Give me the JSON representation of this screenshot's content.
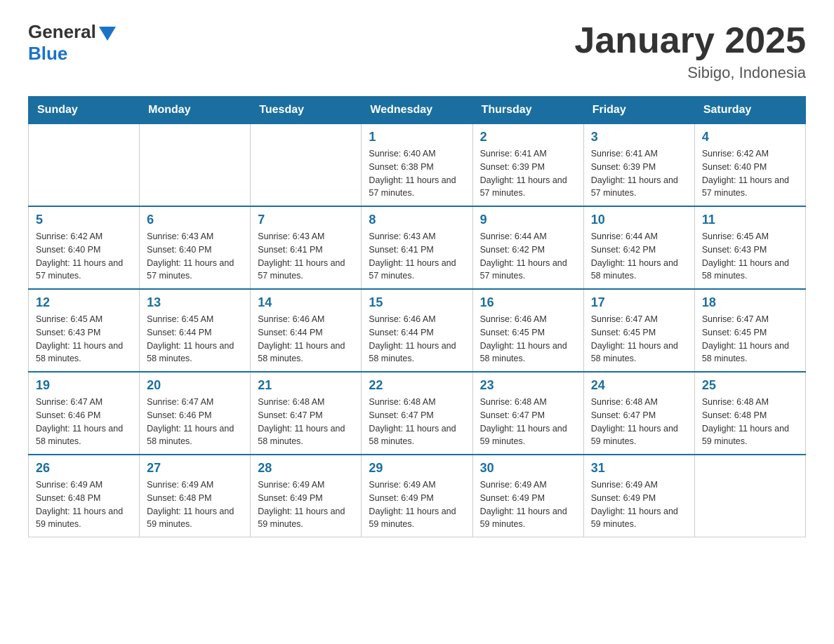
{
  "logo": {
    "general": "General",
    "blue": "Blue"
  },
  "title": "January 2025",
  "subtitle": "Sibigo, Indonesia",
  "days_of_week": [
    "Sunday",
    "Monday",
    "Tuesday",
    "Wednesday",
    "Thursday",
    "Friday",
    "Saturday"
  ],
  "weeks": [
    [
      {
        "day": "",
        "info": ""
      },
      {
        "day": "",
        "info": ""
      },
      {
        "day": "",
        "info": ""
      },
      {
        "day": "1",
        "info": "Sunrise: 6:40 AM\nSunset: 6:38 PM\nDaylight: 11 hours and 57 minutes."
      },
      {
        "day": "2",
        "info": "Sunrise: 6:41 AM\nSunset: 6:39 PM\nDaylight: 11 hours and 57 minutes."
      },
      {
        "day": "3",
        "info": "Sunrise: 6:41 AM\nSunset: 6:39 PM\nDaylight: 11 hours and 57 minutes."
      },
      {
        "day": "4",
        "info": "Sunrise: 6:42 AM\nSunset: 6:40 PM\nDaylight: 11 hours and 57 minutes."
      }
    ],
    [
      {
        "day": "5",
        "info": "Sunrise: 6:42 AM\nSunset: 6:40 PM\nDaylight: 11 hours and 57 minutes."
      },
      {
        "day": "6",
        "info": "Sunrise: 6:43 AM\nSunset: 6:40 PM\nDaylight: 11 hours and 57 minutes."
      },
      {
        "day": "7",
        "info": "Sunrise: 6:43 AM\nSunset: 6:41 PM\nDaylight: 11 hours and 57 minutes."
      },
      {
        "day": "8",
        "info": "Sunrise: 6:43 AM\nSunset: 6:41 PM\nDaylight: 11 hours and 57 minutes."
      },
      {
        "day": "9",
        "info": "Sunrise: 6:44 AM\nSunset: 6:42 PM\nDaylight: 11 hours and 57 minutes."
      },
      {
        "day": "10",
        "info": "Sunrise: 6:44 AM\nSunset: 6:42 PM\nDaylight: 11 hours and 58 minutes."
      },
      {
        "day": "11",
        "info": "Sunrise: 6:45 AM\nSunset: 6:43 PM\nDaylight: 11 hours and 58 minutes."
      }
    ],
    [
      {
        "day": "12",
        "info": "Sunrise: 6:45 AM\nSunset: 6:43 PM\nDaylight: 11 hours and 58 minutes."
      },
      {
        "day": "13",
        "info": "Sunrise: 6:45 AM\nSunset: 6:44 PM\nDaylight: 11 hours and 58 minutes."
      },
      {
        "day": "14",
        "info": "Sunrise: 6:46 AM\nSunset: 6:44 PM\nDaylight: 11 hours and 58 minutes."
      },
      {
        "day": "15",
        "info": "Sunrise: 6:46 AM\nSunset: 6:44 PM\nDaylight: 11 hours and 58 minutes."
      },
      {
        "day": "16",
        "info": "Sunrise: 6:46 AM\nSunset: 6:45 PM\nDaylight: 11 hours and 58 minutes."
      },
      {
        "day": "17",
        "info": "Sunrise: 6:47 AM\nSunset: 6:45 PM\nDaylight: 11 hours and 58 minutes."
      },
      {
        "day": "18",
        "info": "Sunrise: 6:47 AM\nSunset: 6:45 PM\nDaylight: 11 hours and 58 minutes."
      }
    ],
    [
      {
        "day": "19",
        "info": "Sunrise: 6:47 AM\nSunset: 6:46 PM\nDaylight: 11 hours and 58 minutes."
      },
      {
        "day": "20",
        "info": "Sunrise: 6:47 AM\nSunset: 6:46 PM\nDaylight: 11 hours and 58 minutes."
      },
      {
        "day": "21",
        "info": "Sunrise: 6:48 AM\nSunset: 6:47 PM\nDaylight: 11 hours and 58 minutes."
      },
      {
        "day": "22",
        "info": "Sunrise: 6:48 AM\nSunset: 6:47 PM\nDaylight: 11 hours and 58 minutes."
      },
      {
        "day": "23",
        "info": "Sunrise: 6:48 AM\nSunset: 6:47 PM\nDaylight: 11 hours and 59 minutes."
      },
      {
        "day": "24",
        "info": "Sunrise: 6:48 AM\nSunset: 6:47 PM\nDaylight: 11 hours and 59 minutes."
      },
      {
        "day": "25",
        "info": "Sunrise: 6:48 AM\nSunset: 6:48 PM\nDaylight: 11 hours and 59 minutes."
      }
    ],
    [
      {
        "day": "26",
        "info": "Sunrise: 6:49 AM\nSunset: 6:48 PM\nDaylight: 11 hours and 59 minutes."
      },
      {
        "day": "27",
        "info": "Sunrise: 6:49 AM\nSunset: 6:48 PM\nDaylight: 11 hours and 59 minutes."
      },
      {
        "day": "28",
        "info": "Sunrise: 6:49 AM\nSunset: 6:49 PM\nDaylight: 11 hours and 59 minutes."
      },
      {
        "day": "29",
        "info": "Sunrise: 6:49 AM\nSunset: 6:49 PM\nDaylight: 11 hours and 59 minutes."
      },
      {
        "day": "30",
        "info": "Sunrise: 6:49 AM\nSunset: 6:49 PM\nDaylight: 11 hours and 59 minutes."
      },
      {
        "day": "31",
        "info": "Sunrise: 6:49 AM\nSunset: 6:49 PM\nDaylight: 11 hours and 59 minutes."
      },
      {
        "day": "",
        "info": ""
      }
    ]
  ]
}
